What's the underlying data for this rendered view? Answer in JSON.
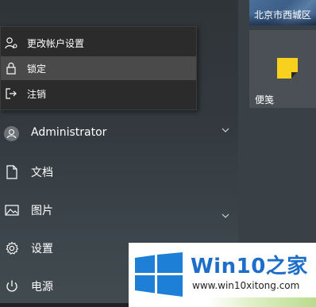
{
  "user_menu": {
    "items": [
      {
        "label": "更改帐户设置",
        "icon": "user-settings-icon"
      },
      {
        "label": "锁定",
        "icon": "lock-icon"
      },
      {
        "label": "注销",
        "icon": "sign-out-icon"
      }
    ]
  },
  "nav": {
    "user": {
      "label": "Administrator",
      "icon": "avatar"
    },
    "documents": {
      "label": "文档",
      "icon": "document-icon"
    },
    "pictures": {
      "label": "图片",
      "icon": "pictures-icon"
    },
    "settings": {
      "label": "设置",
      "icon": "gear-icon"
    },
    "power": {
      "label": "电源",
      "icon": "power-icon"
    }
  },
  "tiles": {
    "map_label": "北京市西城区",
    "sticky_label": "便笺"
  },
  "watermark": {
    "brand_prefix": "Win10",
    "brand_suffix": "之家",
    "url": "www.win10xitong.com"
  },
  "colors": {
    "menu_bg": "#2b2b2b",
    "menu_selected": "#4a4a4a",
    "sticky_yellow": "#f7d11e",
    "windows_blue": "#1d7fd6"
  }
}
